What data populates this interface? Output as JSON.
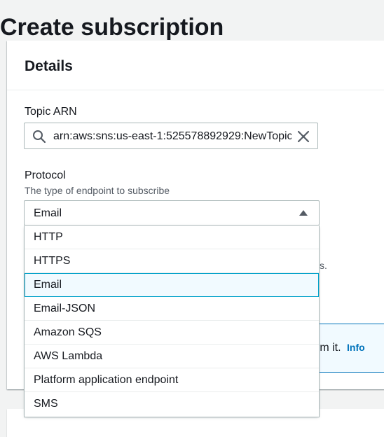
{
  "page": {
    "title": "Create subscription"
  },
  "details": {
    "heading": "Details",
    "topic_arn": {
      "label": "Topic ARN",
      "value": "arn:aws:sns:us-east-1:525578892929:NewTopic"
    },
    "protocol": {
      "label": "Protocol",
      "description": "The type of endpoint to subscribe",
      "selected": "Email",
      "options": [
        "HTTP",
        "HTTPS",
        "Email",
        "Email-JSON",
        "Amazon SQS",
        "AWS Lambda",
        "Platform application endpoint",
        "SMS"
      ]
    },
    "hidden_hint_fragment": "s.",
    "alert": {
      "text_fragment": "firm it.",
      "link": "Info"
    }
  },
  "colors": {
    "accent": "#0073bb",
    "selected_border": "#00a1c9",
    "selected_bg": "#f1faff",
    "page_bg": "#f2f3f3"
  },
  "icons": {
    "search": "search-icon",
    "clear": "close-icon",
    "caret": "caret-up-icon"
  }
}
